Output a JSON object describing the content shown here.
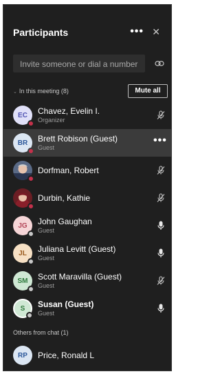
{
  "header": {
    "title": "Participants"
  },
  "invite": {
    "placeholder": "Invite someone or dial a number"
  },
  "in_meeting": {
    "label": "In this meeting (8)",
    "mute_all_label": "Mute all",
    "participants": [
      {
        "initials": "EC",
        "name": "Chavez, Evelin I.",
        "role": "Organizer",
        "avatar_bg": "#e0e0f8",
        "avatar_fg": "#4f52b2",
        "status_color": "#c4314b",
        "mic": "muted"
      },
      {
        "initials": "BR",
        "name": "Brett Robison (Guest)",
        "role": "Guest",
        "avatar_bg": "#dbe6f3",
        "avatar_fg": "#2b579a",
        "status_color": "#c4314b",
        "mic": "more"
      },
      {
        "initials": "",
        "name": "Dorfman, Robert",
        "role": "",
        "status_color": "#c4314b",
        "mic": "muted"
      },
      {
        "initials": "",
        "name": "Durbin, Kathie",
        "role": "",
        "status_color": "#c4314b",
        "mic": "muted"
      },
      {
        "initials": "JG",
        "name": "John Gaughan",
        "role": "Guest",
        "avatar_bg": "#f6d5d7",
        "avatar_fg": "#b4475a",
        "status_color": "#c8c8c8",
        "mic": "on"
      },
      {
        "initials": "JL",
        "name": "Juliana Levitt (Guest)",
        "role": "Guest",
        "avatar_bg": "#f7e0c4",
        "avatar_fg": "#9a5a1c",
        "status_color": "#c8c8c8",
        "mic": "on"
      },
      {
        "initials": "SM",
        "name": "Scott Maravilla (Guest)",
        "role": "Guest",
        "avatar_bg": "#cfe8d4",
        "avatar_fg": "#2f7a3d",
        "status_color": "#c8c8c8",
        "mic": "muted"
      },
      {
        "initials": "S",
        "name": "Susan (Guest)",
        "role": "Guest",
        "avatar_bg": "#cfe8d4",
        "avatar_fg": "#2f7a3d",
        "status_color": "#c8c8c8",
        "mic": "on"
      }
    ]
  },
  "others": {
    "label": "Others from chat (1)",
    "participants": [
      {
        "initials": "RP",
        "name": "Price, Ronald L",
        "role": "",
        "avatar_bg": "#dbe6f3",
        "avatar_fg": "#2b579a"
      }
    ]
  }
}
